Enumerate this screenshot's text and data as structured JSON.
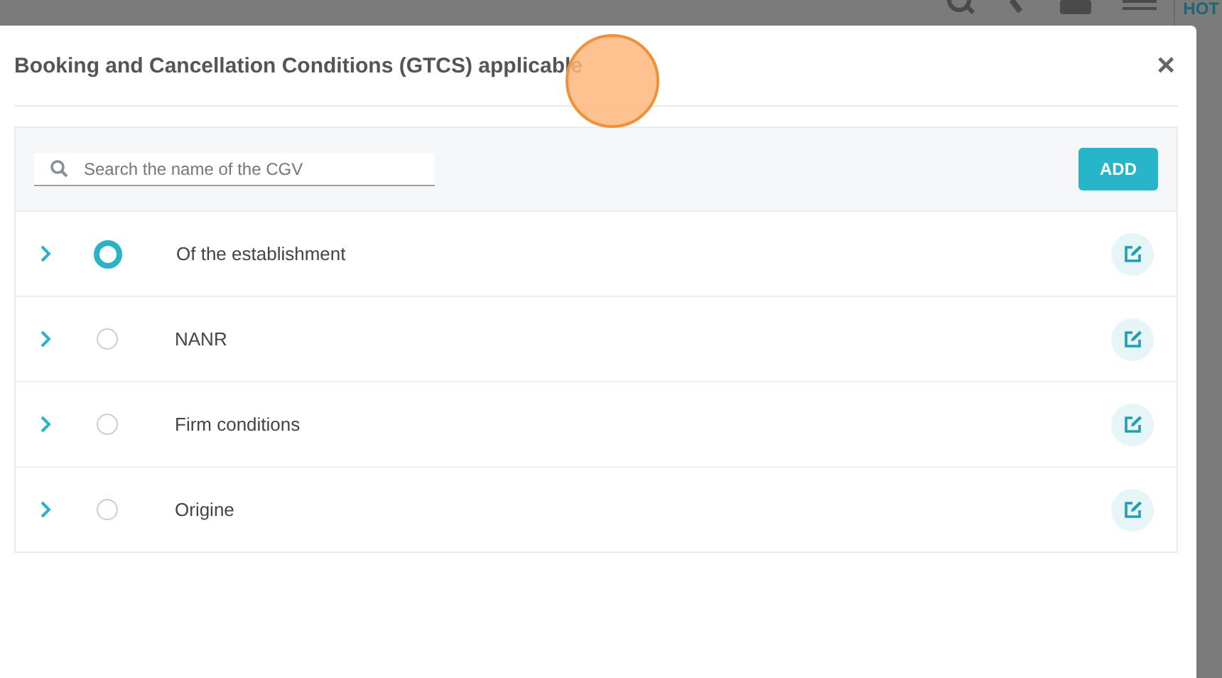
{
  "background": {
    "header_text": "HOT"
  },
  "dialog": {
    "title": "Booking and Cancellation Conditions (GTCS) applicable",
    "close": "×"
  },
  "search": {
    "placeholder": "Search the name of the CGV"
  },
  "add_button": "ADD",
  "conditions": [
    {
      "label": "Of the establishment",
      "selected": true
    },
    {
      "label": "NANR",
      "selected": false
    },
    {
      "label": "Firm conditions",
      "selected": false
    },
    {
      "label": "Origine",
      "selected": false
    }
  ]
}
